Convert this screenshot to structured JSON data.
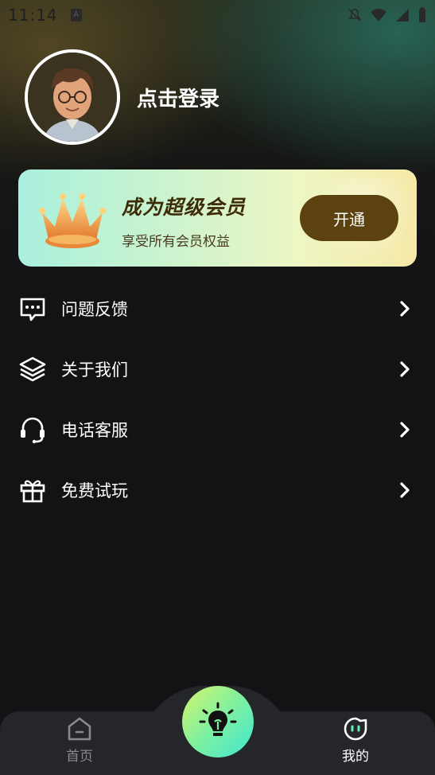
{
  "status_bar": {
    "time": "11:14",
    "notification_badge": "A"
  },
  "profile": {
    "login_label": "点击登录"
  },
  "vip_card": {
    "title": "成为超级会员",
    "subtitle": "享受所有会员权益",
    "button_label": "开通"
  },
  "menu": {
    "items": [
      {
        "label": "问题反馈",
        "icon": "chat-bubble-icon"
      },
      {
        "label": "关于我们",
        "icon": "layers-icon"
      },
      {
        "label": "电话客服",
        "icon": "headset-icon"
      },
      {
        "label": "免费试玩",
        "icon": "gift-icon"
      }
    ]
  },
  "tabbar": {
    "home_label": "首页",
    "mine_label": "我的",
    "active_tab": "我的"
  },
  "colors": {
    "background": "#131316",
    "vip_button": "#5c420f",
    "tabbar": "#25262a",
    "center_button_start": "#d6f56a",
    "center_button_end": "#3fe6d0"
  }
}
